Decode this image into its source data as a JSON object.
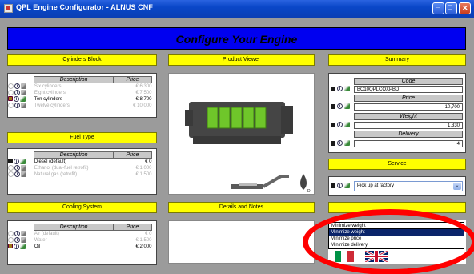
{
  "window": {
    "title": "QPL Engine Configurator - ALNUS CNF"
  },
  "banner": {
    "title": "Configure Your Engine"
  },
  "cylinders": {
    "header": "Cylinders Block",
    "col_desc": "Description",
    "col_price": "Price",
    "options": [
      {
        "label": "Six cylinders",
        "price": "€ 6,300",
        "selected": false
      },
      {
        "label": "Eight cylinders",
        "price": "€ 7,500",
        "selected": false
      },
      {
        "label": "Ten cylinders",
        "price": "€ 8,700",
        "selected": true
      },
      {
        "label": "Twelve cylinders",
        "price": "€ 10,000",
        "selected": false
      }
    ]
  },
  "fuel": {
    "header": "Fuel Type",
    "col_desc": "Description",
    "col_price": "Price",
    "options": [
      {
        "label": "Diesel (default)",
        "price": "€ 0",
        "selected": true
      },
      {
        "label": "Ethanol (dual-fuel retrofit)",
        "price": "€ 1,000",
        "selected": false
      },
      {
        "label": "Natural gas (retrofit)",
        "price": "€ 1,500",
        "selected": false
      }
    ]
  },
  "cooling": {
    "header": "Cooling System",
    "col_desc": "Description",
    "col_price": "Price",
    "options": [
      {
        "label": "Air (default)",
        "price": "€ 0",
        "selected": false
      },
      {
        "label": "Water",
        "price": "€ 1,500",
        "selected": false
      },
      {
        "label": "Oil",
        "price": "€ 2,000",
        "selected": true
      }
    ]
  },
  "viewer": {
    "header": "Product Viewer"
  },
  "details": {
    "header": "Details and Notes"
  },
  "summary": {
    "header": "Summary",
    "code_label": "Code",
    "code_value": "BC10QPLCOXPBD",
    "price_label": "Price",
    "price_value": "10,700",
    "weight_label": "Weight",
    "weight_value": "1,330",
    "delivery_label": "Delivery",
    "delivery_value": "4"
  },
  "service": {
    "header": "Service",
    "selected": "Pick up at factory"
  },
  "optimize": {
    "selected": "Minimize weight",
    "options": [
      "Minimize weight",
      "Minimize price",
      "Minimize delivery"
    ],
    "highlighted": "Minimize weight"
  },
  "colors": {
    "banner": "#0000f0",
    "panel": "#ffff00",
    "background": "#9b9b9b",
    "engine": "#6fc62a"
  }
}
